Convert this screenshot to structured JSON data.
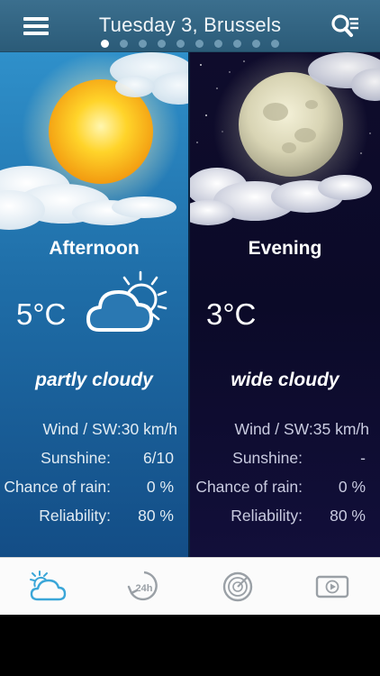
{
  "header": {
    "title": "Tuesday 3, Brussels",
    "page_count": 10,
    "active_page": 0
  },
  "panels": {
    "afternoon": {
      "period": "Afternoon",
      "temperature": "5°C",
      "icon": "partly-cloudy-icon",
      "condition": "partly cloudy",
      "wind": "Wind / SW:30 km/h",
      "sunshine_label": "Sunshine:",
      "sunshine_value": "6/10",
      "rain_label": "Chance of rain:",
      "rain_value": "0 %",
      "reliability_label": "Reliability:",
      "reliability_value": "80 %"
    },
    "evening": {
      "period": "Evening",
      "temperature": "3°C",
      "condition": "wide cloudy",
      "wind": "Wind / SW:35 km/h",
      "sunshine_label": "Sunshine:",
      "sunshine_value": "-",
      "rain_label": "Chance of rain:",
      "rain_value": "0 %",
      "reliability_label": "Reliability:",
      "reliability_value": "80 %"
    }
  },
  "tabbar": {
    "tabs": [
      {
        "icon": "weather-icon",
        "active": true
      },
      {
        "icon": "24h-forecast-icon",
        "active": false
      },
      {
        "icon": "radar-icon",
        "active": false
      },
      {
        "icon": "video-play-icon",
        "active": false
      }
    ]
  },
  "colors": {
    "header_bg": "#3b6f8e",
    "day_panel": "#1f6ea8",
    "night_panel": "#0b0a28",
    "tab_active": "#3aa6d8",
    "tab_inactive": "#9aa0a6"
  }
}
